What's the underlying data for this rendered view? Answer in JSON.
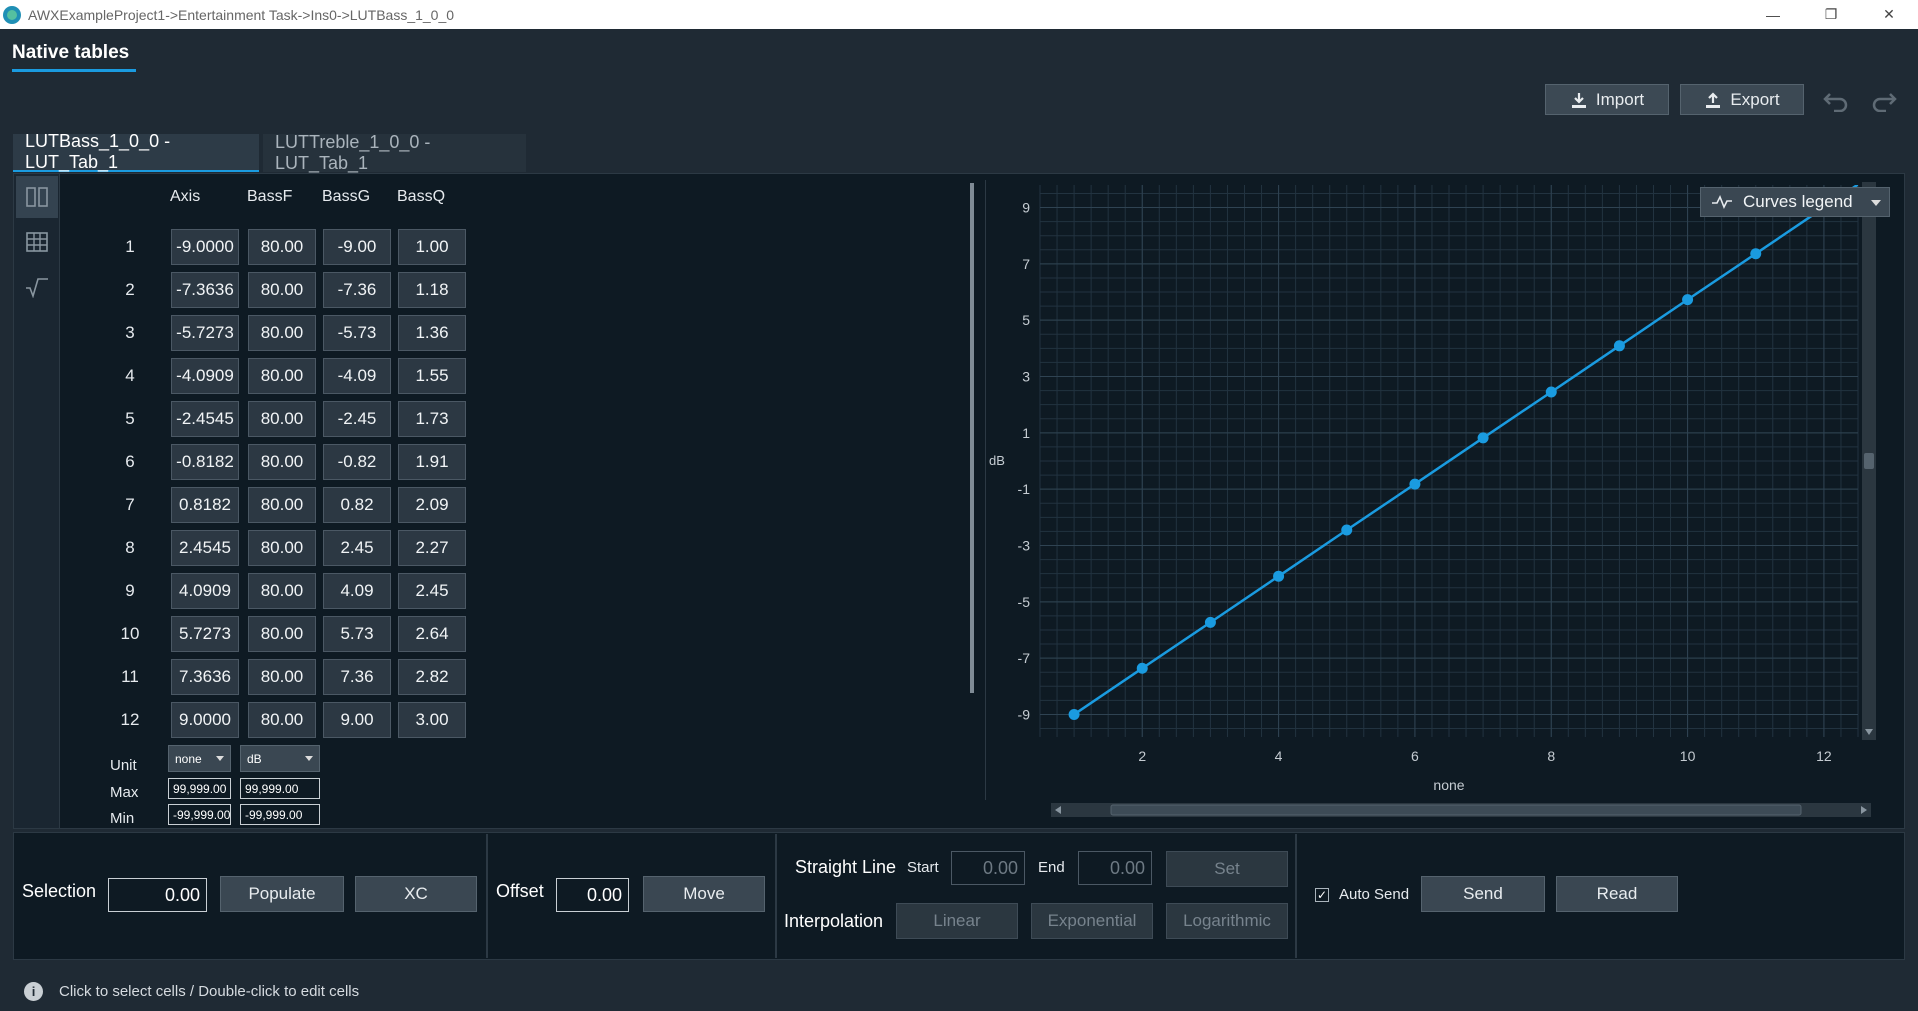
{
  "window": {
    "title": "AWXExampleProject1->Entertainment Task->Ins0->LUTBass_1_0_0",
    "minimize": "—",
    "restore": "❐",
    "close": "✕"
  },
  "page_title": "Native tables",
  "toolbar": {
    "import_label": "Import",
    "export_label": "Export",
    "undo_icon": "undo-icon",
    "redo_icon": "redo-icon"
  },
  "tabs": [
    {
      "label": "LUTBass_1_0_0 - LUT_Tab_1",
      "active": true
    },
    {
      "label": "LUTTreble_1_0_0 - LUT_Tab_1",
      "active": false
    }
  ],
  "table": {
    "columns": [
      "Axis",
      "BassF",
      "BassG",
      "BassQ"
    ],
    "rows": [
      {
        "n": "1",
        "cells": [
          "-9.0000",
          "80.00",
          "-9.00",
          "1.00"
        ]
      },
      {
        "n": "2",
        "cells": [
          "-7.3636",
          "80.00",
          "-7.36",
          "1.18"
        ]
      },
      {
        "n": "3",
        "cells": [
          "-5.7273",
          "80.00",
          "-5.73",
          "1.36"
        ]
      },
      {
        "n": "4",
        "cells": [
          "-4.0909",
          "80.00",
          "-4.09",
          "1.55"
        ]
      },
      {
        "n": "5",
        "cells": [
          "-2.4545",
          "80.00",
          "-2.45",
          "1.73"
        ]
      },
      {
        "n": "6",
        "cells": [
          "-0.8182",
          "80.00",
          "-0.82",
          "1.91"
        ]
      },
      {
        "n": "7",
        "cells": [
          "0.8182",
          "80.00",
          "0.82",
          "2.09"
        ]
      },
      {
        "n": "8",
        "cells": [
          "2.4545",
          "80.00",
          "2.45",
          "2.27"
        ]
      },
      {
        "n": "9",
        "cells": [
          "4.0909",
          "80.00",
          "4.09",
          "2.45"
        ]
      },
      {
        "n": "10",
        "cells": [
          "5.7273",
          "80.00",
          "5.73",
          "2.64"
        ]
      },
      {
        "n": "11",
        "cells": [
          "7.3636",
          "80.00",
          "7.36",
          "2.82"
        ]
      },
      {
        "n": "12",
        "cells": [
          "9.0000",
          "80.00",
          "9.00",
          "3.00"
        ]
      }
    ],
    "unit_label": "Unit",
    "max_label": "Max",
    "min_label": "Min",
    "unit_axis": "none",
    "unit_value": "dB",
    "max_axis": "99,999.00",
    "max_value": "99,999.00",
    "min_axis": "-99,999.00",
    "min_value": "-99,999.00"
  },
  "chart_data": {
    "type": "line",
    "x": [
      1,
      2,
      3,
      4,
      5,
      6,
      7,
      8,
      9,
      10,
      11,
      12
    ],
    "series": [
      {
        "name": "",
        "values": [
          -9.0,
          -7.36,
          -5.73,
          -4.09,
          -2.45,
          -0.82,
          0.82,
          2.45,
          4.09,
          5.73,
          7.36,
          9.0
        ],
        "color": "#1a9be0"
      }
    ],
    "xlabel": "none",
    "ylabel": "dB",
    "xlim": [
      0.5,
      12.5
    ],
    "ylim": [
      -9.8,
      9.8
    ],
    "xticks": [
      2,
      4,
      6,
      8,
      10,
      12
    ],
    "yticks": [
      -9,
      -7,
      -5,
      -3,
      -1,
      1,
      3,
      5,
      7,
      9
    ],
    "grid": true,
    "legend_button": "Curves legend"
  },
  "bottom": {
    "selection_label": "Selection",
    "selection_value": "0.00",
    "populate_label": "Populate",
    "xc_label": "XC",
    "offset_label": "Offset",
    "offset_value": "0.00",
    "move_label": "Move",
    "straight_line_label": "Straight Line",
    "start_label": "Start",
    "start_value": "0.00",
    "end_label": "End",
    "end_value": "0.00",
    "set_label": "Set",
    "interpolation_label": "Interpolation",
    "linear_label": "Linear",
    "exponential_label": "Exponential",
    "logarithmic_label": "Logarithmic",
    "auto_send_label": "Auto Send",
    "auto_send_checked": true,
    "send_label": "Send",
    "read_label": "Read"
  },
  "status": {
    "text": "Click to select cells / Double-click to edit cells"
  },
  "colors": {
    "accent": "#1a9be0",
    "background": "#1f2a34",
    "panel": "#0e1a23"
  }
}
